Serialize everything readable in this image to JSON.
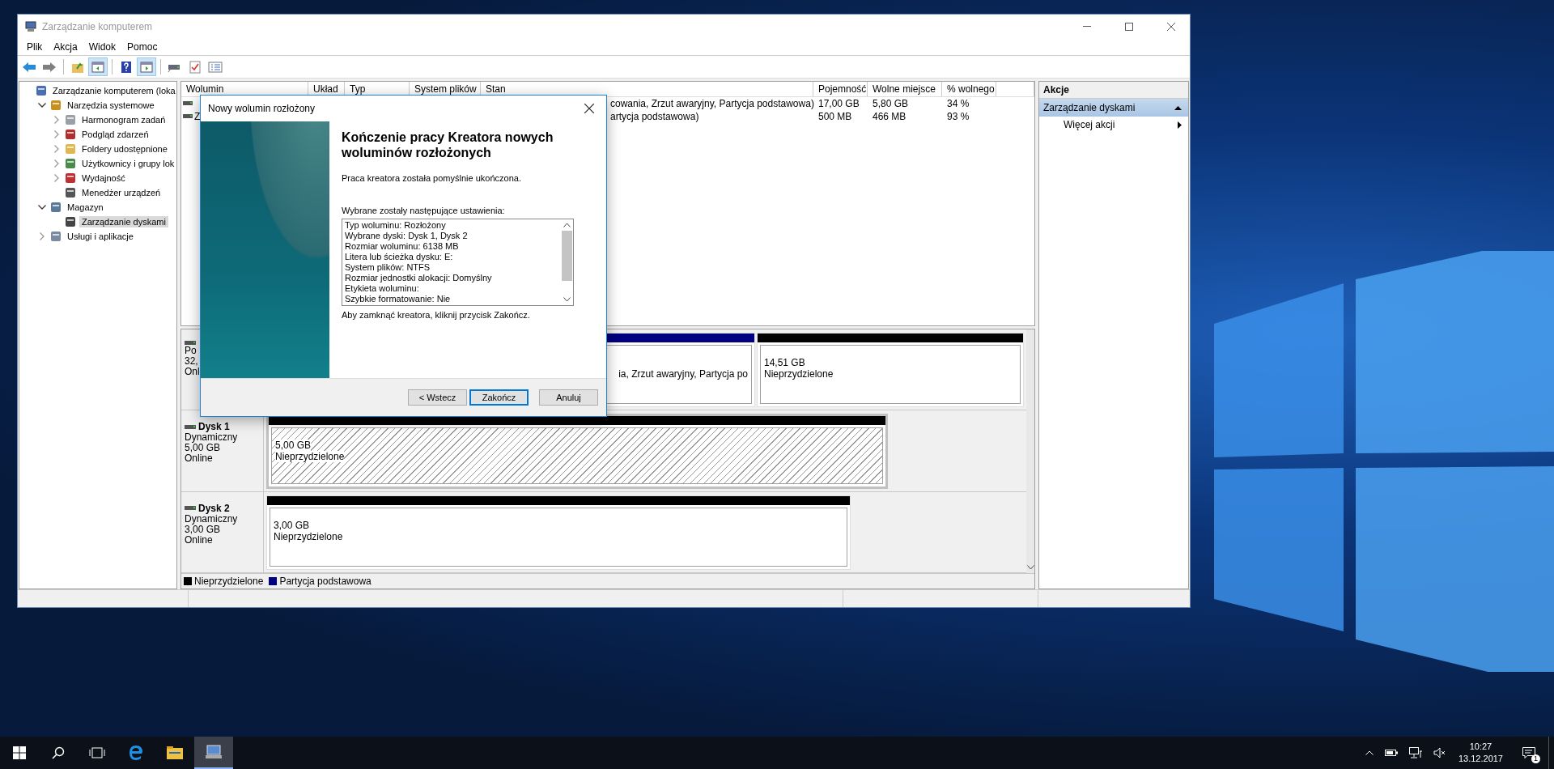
{
  "window": {
    "title": "Zarządzanie komputerem"
  },
  "menu": [
    "Plik",
    "Akcja",
    "Widok",
    "Pomoc"
  ],
  "toolbar": [
    {
      "pressed": false
    },
    {
      "pressed": false
    },
    {
      "pressed": false
    },
    {
      "pressed": true
    },
    {
      "pressed": false
    },
    {
      "pressed": true
    },
    {
      "pressed": false
    },
    {
      "pressed": false
    },
    {
      "pressed": false
    }
  ],
  "tree": [
    {
      "label": "Zarządzanie komputerem (loka",
      "expandable": false,
      "selected": false,
      "children": [
        {
          "label": "Narzędzia systemowe",
          "expandable": true,
          "expanded": true,
          "selected": false,
          "children": [
            {
              "label": "Harmonogram zadań",
              "expandable": true,
              "expanded": false,
              "selected": false
            },
            {
              "label": "Podgląd zdarzeń",
              "expandable": true,
              "expanded": false,
              "selected": false
            },
            {
              "label": "Foldery udostępnione",
              "expandable": true,
              "expanded": false,
              "selected": false
            },
            {
              "label": "Użytkownicy i grupy lok",
              "expandable": true,
              "expanded": false,
              "selected": false
            },
            {
              "label": "Wydajność",
              "expandable": true,
              "expanded": false,
              "selected": false
            },
            {
              "label": "Menedżer urządzeń",
              "expandable": false,
              "selected": false
            }
          ]
        },
        {
          "label": "Magazyn",
          "expandable": true,
          "expanded": true,
          "selected": false,
          "children": [
            {
              "label": "Zarządzanie dyskami",
              "expandable": false,
              "selected": true
            }
          ]
        },
        {
          "label": "Usługi i aplikacje",
          "expandable": true,
          "expanded": false,
          "selected": false
        }
      ]
    }
  ],
  "volumes": {
    "columns": [
      "Wolumin",
      "Układ",
      "Typ",
      "System plików",
      "Stan",
      "Pojemność",
      "Wolne miejsce",
      "% wolnego"
    ],
    "rows": [
      {
        "status": "cowania, Zrzut awaryjny, Partycja podstawowa)",
        "capacity": "17,00 GB",
        "free": "5,80 GB",
        "percent_free": "34 %"
      },
      {
        "volume": "Z",
        "status": "artycja podstawowa)",
        "capacity": "500 MB",
        "free": "466 MB",
        "percent_free": "93 %"
      }
    ]
  },
  "disks": [
    {
      "type": "Po",
      "size": "32,",
      "state": "Onl",
      "partitions": [
        {
          "details": "ia, Zrzut awaryjny, Partycja po",
          "color": "#000080",
          "selected": false
        },
        {
          "size": "14,51 GB",
          "details": "Nieprzydzielone",
          "color": "#000000",
          "selected": false
        }
      ]
    },
    {
      "name": "Dysk 1",
      "type": "Dynamiczny",
      "size": "5,00 GB",
      "state": "Online",
      "partitions": [
        {
          "size": "5,00 GB",
          "details": "Nieprzydzielone",
          "color": "#000000",
          "selected": true
        }
      ]
    },
    {
      "name": "Dysk 2",
      "type": "Dynamiczny",
      "size": "3,00 GB",
      "state": "Online",
      "partitions": [
        {
          "size": "3,00 GB",
          "details": "Nieprzydzielone",
          "color": "#000000",
          "selected": false
        }
      ]
    }
  ],
  "legend": [
    {
      "label": "Nieprzydzielone",
      "color": "#000000"
    },
    {
      "label": "Partycja podstawowa",
      "color": "#000080"
    }
  ],
  "actions": {
    "header": "Akcje",
    "sections": [
      {
        "label": "Zarządzanie dyskami",
        "expanded": true,
        "items": [
          "Więcej akcji"
        ]
      }
    ]
  },
  "dialog": {
    "title": "Nowy wolumin rozłożony",
    "heading": "Kończenie pracy Kreatora nowych woluminów rozłożonych",
    "intro": "Praca kreatora została pomyślnie ukończona.",
    "settings_label": "Wybrane zostały następujące ustawienia:",
    "settings": [
      "Typ woluminu: Rozłożony",
      "Wybrane dyski: Dysk 1, Dysk 2",
      "Rozmiar woluminu: 6138 MB",
      "Litera lub ścieżka dysku: E:",
      "System plików: NTFS",
      "Rozmiar jednostki alokacji: Domyślny",
      "Etykieta woluminu:",
      "Szybkie formatowanie: Nie"
    ],
    "outro": "Aby zamknąć kreatora, kliknij przycisk Zakończ.",
    "buttons": [
      {
        "label": "< Wstecz",
        "default": false
      },
      {
        "label": "Zakończ",
        "default": true
      },
      {
        "label": "Anuluj",
        "default": false
      }
    ]
  },
  "taskbar": {
    "apps": [
      {
        "selected": false
      },
      {
        "selected": false
      },
      {
        "selected": true
      }
    ],
    "time": "10:27",
    "date": "13.12.2017",
    "notifications": "1"
  }
}
